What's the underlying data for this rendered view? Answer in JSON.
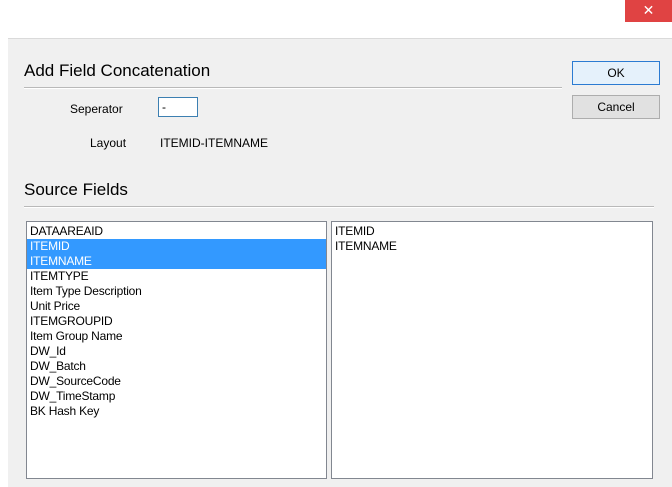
{
  "window": {
    "close_glyph": "✕"
  },
  "dialog": {
    "title": "Add Field Concatenation",
    "separator_label": "Seperator",
    "separator_value": "-",
    "layout_label": "Layout",
    "layout_value": "ITEMID-ITEMNAME",
    "source_title": "Source Fields",
    "ok_label": "OK",
    "cancel_label": "Cancel"
  },
  "source_fields": [
    {
      "label": "DATAAREAID",
      "selected": false
    },
    {
      "label": "ITEMID",
      "selected": true
    },
    {
      "label": "ITEMNAME",
      "selected": true
    },
    {
      "label": "ITEMTYPE",
      "selected": false
    },
    {
      "label": "Item Type Description",
      "selected": false
    },
    {
      "label": "Unit Price",
      "selected": false
    },
    {
      "label": "ITEMGROUPID",
      "selected": false
    },
    {
      "label": "Item Group Name",
      "selected": false
    },
    {
      "label": "DW_Id",
      "selected": false
    },
    {
      "label": "DW_Batch",
      "selected": false
    },
    {
      "label": "DW_SourceCode",
      "selected": false
    },
    {
      "label": "DW_TimeStamp",
      "selected": false
    },
    {
      "label": "BK Hash Key",
      "selected": false
    }
  ],
  "selected_fields": [
    "ITEMID",
    "ITEMNAME"
  ],
  "colors": {
    "selection": "#3399ff",
    "close_button": "#e04343",
    "dialog_bg": "#f0f0f0"
  }
}
